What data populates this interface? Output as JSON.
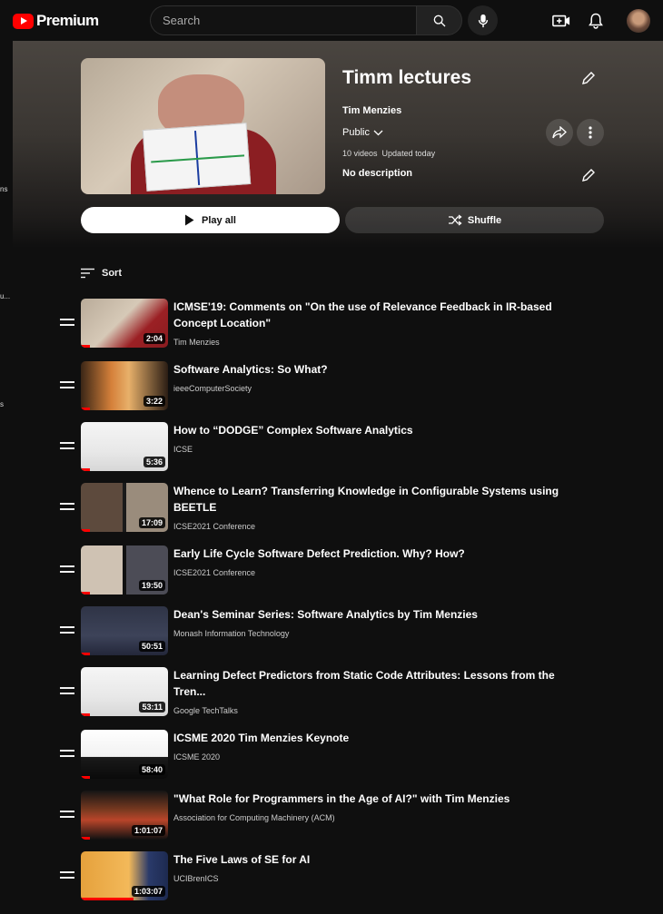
{
  "app": {
    "logo_text": "Premium"
  },
  "search": {
    "placeholder": "Search"
  },
  "rail": [
    "ns",
    "u...",
    "s"
  ],
  "playlist": {
    "title": "Timm lectures",
    "author": "Tim Menzies",
    "privacy": "Public",
    "videos_count": "10 videos",
    "updated": "Updated today",
    "description": "No description",
    "play_all_label": "Play all",
    "shuffle_label": "Shuffle",
    "sort_label": "Sort"
  },
  "videos": [
    {
      "title": "ICMSE'19: Comments on \"On the use of Relevance Feedback in IR-based Concept Location\"",
      "channel": "Tim Menzies",
      "duration": "2:04",
      "progress": 0.1,
      "theme": "hero"
    },
    {
      "title": "Software Analytics: So What?",
      "channel": "ieeeComputerSociety",
      "duration": "3:22",
      "progress": 0.1,
      "theme": "warm"
    },
    {
      "title": "How to “DODGE” Complex Software Analytics",
      "channel": "ICSE",
      "duration": "5:36",
      "progress": 0.1,
      "theme": "slide-white"
    },
    {
      "title": "Whence to Learn? Transferring Knowledge in Configurable Systems using BEETLE",
      "channel": "ICSE2021 Conference",
      "duration": "17:09",
      "progress": 0.1,
      "theme": "zoom"
    },
    {
      "title": "Early Life Cycle Software Defect Prediction. Why? How?",
      "channel": "ICSE2021 Conference",
      "duration": "19:50",
      "progress": 0.1,
      "theme": "zoom2"
    },
    {
      "title": "Dean's Seminar Series: Software Analytics by Tim Menzies",
      "channel": "Monash Information Technology",
      "duration": "50:51",
      "progress": 0.1,
      "theme": "dark-slide"
    },
    {
      "title": "Learning Defect Predictors from Static Code Attributes: Lessons from the Tren...",
      "channel": "Google TechTalks",
      "duration": "53:11",
      "progress": 0.1,
      "theme": "slide-white"
    },
    {
      "title": "ICSME 2020 Tim Menzies Keynote",
      "channel": "ICSME 2020",
      "duration": "58:40",
      "progress": 0.1,
      "theme": "keynote"
    },
    {
      "title": "\"What Role for Programmers in the Age of AI?\" with Tim Menzies",
      "channel": "Association for Computing Machinery (ACM)",
      "duration": "1:01:07",
      "progress": 0.1,
      "theme": "acm"
    },
    {
      "title": "The Five Laws of SE for AI",
      "channel": "UCIBrenICS",
      "duration": "1:03:07",
      "progress": 0.6,
      "theme": "uci"
    }
  ]
}
